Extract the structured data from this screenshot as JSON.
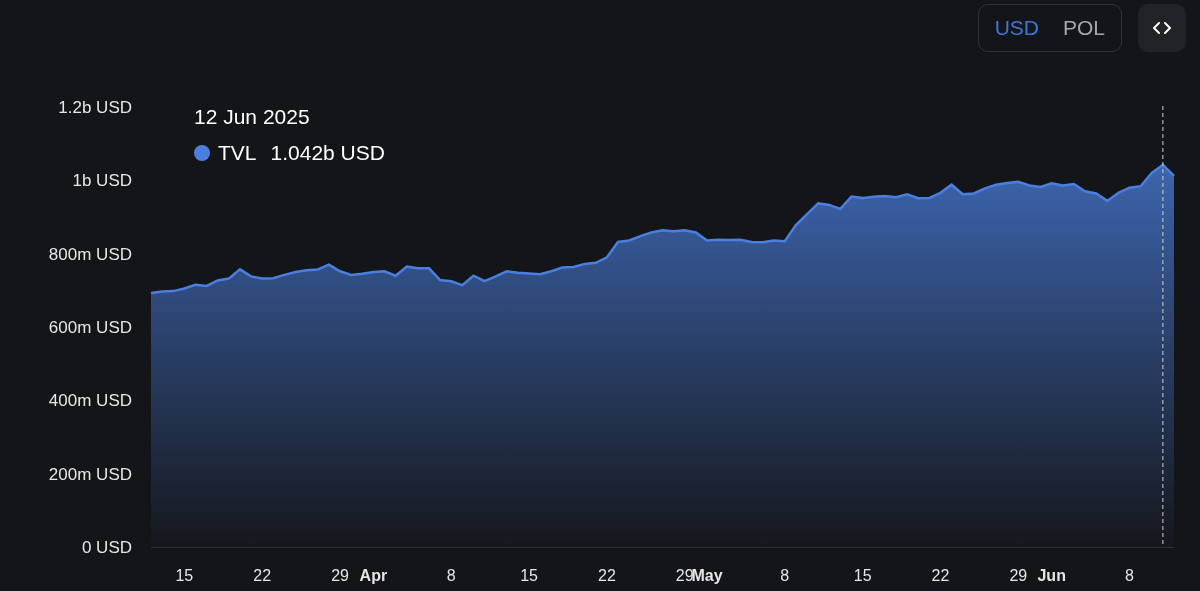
{
  "currency_toggle": [
    {
      "label": "USD",
      "selected": true
    },
    {
      "label": "POL",
      "selected": false
    }
  ],
  "embed_button": {
    "kind": "code"
  },
  "tooltip": {
    "date": "12 Jun 2025",
    "value": "1.042b USD"
  },
  "chart_data": {
    "type": "area",
    "categories": [
      null,
      null,
      null,
      "15",
      null,
      null,
      null,
      null,
      null,
      null,
      "22",
      null,
      null,
      null,
      null,
      null,
      null,
      "29",
      null,
      null,
      "Apr",
      null,
      null,
      null,
      null,
      null,
      null,
      "8",
      null,
      null,
      null,
      null,
      null,
      null,
      "15",
      null,
      null,
      null,
      null,
      null,
      null,
      "22",
      null,
      null,
      null,
      null,
      null,
      null,
      "29",
      null,
      "May",
      null,
      null,
      null,
      null,
      null,
      null,
      "8",
      null,
      null,
      null,
      null,
      null,
      null,
      "15",
      null,
      null,
      null,
      null,
      null,
      null,
      "22",
      null,
      null,
      null,
      null,
      null,
      null,
      "29",
      null,
      null,
      "Jun",
      null,
      null,
      null,
      null,
      null,
      null,
      "8",
      null,
      null,
      null,
      null
    ],
    "series": [
      {
        "name": "TVL",
        "color": "#4a7fe0",
        "values": [
          693000000,
          697000000,
          698000000,
          705000000,
          715000000,
          712000000,
          727000000,
          732000000,
          757000000,
          738000000,
          732000000,
          733000000,
          742000000,
          750000000,
          755000000,
          757000000,
          770000000,
          752000000,
          742000000,
          745000000,
          750000000,
          752000000,
          740000000,
          765000000,
          760000000,
          760000000,
          728000000,
          725000000,
          714000000,
          740000000,
          725000000,
          738000000,
          752000000,
          748000000,
          746000000,
          744000000,
          752000000,
          762000000,
          764000000,
          772000000,
          775000000,
          790000000,
          832000000,
          836000000,
          848000000,
          858000000,
          864000000,
          861000000,
          864000000,
          858000000,
          836000000,
          838000000,
          837000000,
          838000000,
          832000000,
          831000000,
          836000000,
          834000000,
          878000000,
          908000000,
          937000000,
          933000000,
          922000000,
          956000000,
          952000000,
          955000000,
          957000000,
          954000000,
          962000000,
          951000000,
          952000000,
          966000000,
          988000000,
          962000000,
          964000000,
          978000000,
          988000000,
          993000000,
          996000000,
          986000000,
          982000000,
          992000000,
          986000000,
          990000000,
          970000000,
          964000000,
          944000000,
          966000000,
          980000000,
          984000000,
          1020000000,
          1042000000,
          1012000000
        ]
      }
    ],
    "ylim": [
      0,
      1200000000
    ],
    "yticks": [
      {
        "value": 0,
        "label": "0 USD"
      },
      {
        "value": 200000000,
        "label": "200m USD"
      },
      {
        "value": 400000000,
        "label": "400m USD"
      },
      {
        "value": 600000000,
        "label": "600m USD"
      },
      {
        "value": 800000000,
        "label": "800m USD"
      },
      {
        "value": 1000000000,
        "label": "1b USD"
      },
      {
        "value": 1200000000,
        "label": "1.2b USD"
      }
    ]
  }
}
